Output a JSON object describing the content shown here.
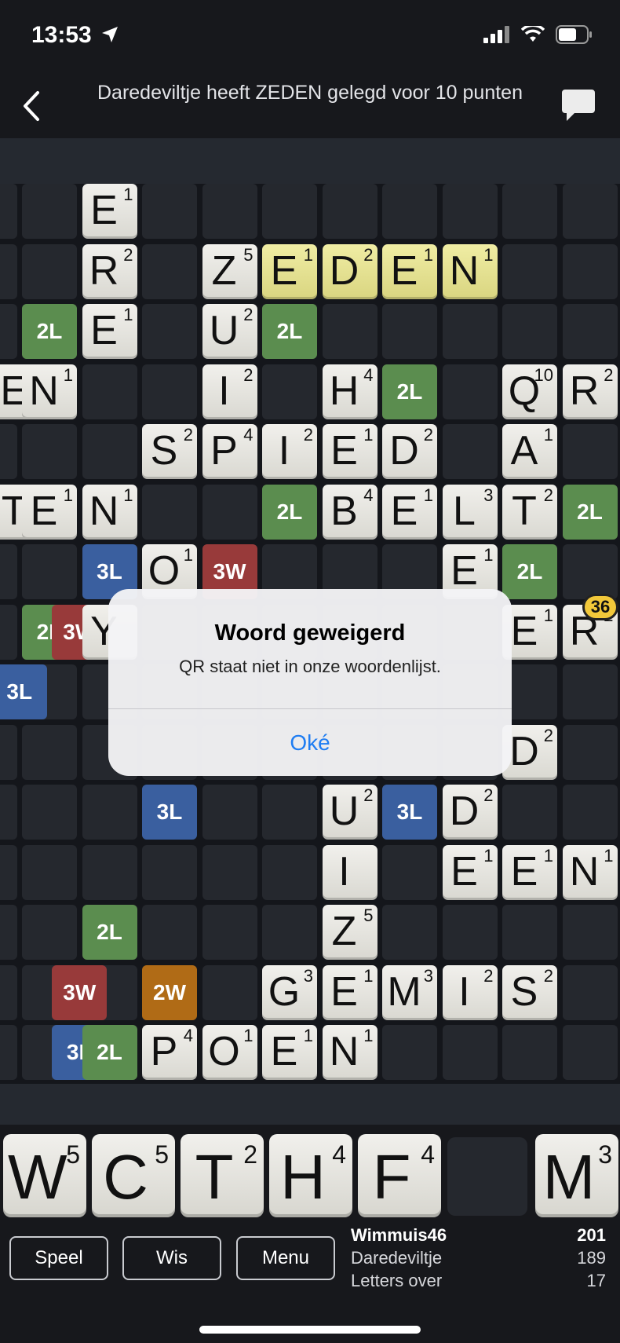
{
  "status": {
    "time": "13:53"
  },
  "nav": {
    "title": "Daredeviltje heeft ZEDEN gelegd voor 10 punten"
  },
  "colors": {
    "accent": "#1f7df2",
    "last_move": "#e6e298",
    "score_badge": "#f2c83a"
  },
  "board": {
    "bonuses": [
      {
        "r": 2,
        "c": 0,
        "t": "2L"
      },
      {
        "r": 2,
        "c": 4,
        "t": "2L"
      },
      {
        "r": 3,
        "c": 6,
        "t": "2L"
      },
      {
        "r": 5,
        "c": 4,
        "t": "2L"
      },
      {
        "r": 5,
        "c": 9,
        "t": "2L"
      },
      {
        "r": 6,
        "c": 1,
        "t": "3L"
      },
      {
        "r": 6,
        "c": 3,
        "t": "3W"
      },
      {
        "r": 6,
        "c": 8,
        "t": "2L"
      },
      {
        "r": 7,
        "c": 0,
        "t": "2L"
      },
      {
        "r": 7,
        "c": 0.5,
        "t": "3W"
      },
      {
        "r": 8,
        "c": -0.5,
        "t": "3L"
      },
      {
        "r": 10,
        "c": 2,
        "t": "3L"
      },
      {
        "r": 10,
        "c": 6,
        "t": "3L"
      },
      {
        "r": 12,
        "c": 1,
        "t": "2L"
      },
      {
        "r": 13,
        "c": 0.5,
        "t": "3W"
      },
      {
        "r": 13,
        "c": 2,
        "t": "2W"
      },
      {
        "r": 14,
        "c": 0.5,
        "t": "3L"
      },
      {
        "r": 14,
        "c": 1,
        "t": "2L"
      }
    ],
    "tiles": [
      {
        "r": 0,
        "c": 1,
        "l": "E",
        "p": "1"
      },
      {
        "r": 1,
        "c": 1,
        "l": "R",
        "p": "2"
      },
      {
        "r": 1,
        "c": 3,
        "l": "Z",
        "p": "5"
      },
      {
        "r": 1,
        "c": 4,
        "l": "E",
        "p": "1",
        "last": true
      },
      {
        "r": 1,
        "c": 5,
        "l": "D",
        "p": "2",
        "last": true
      },
      {
        "r": 1,
        "c": 6,
        "l": "E",
        "p": "1",
        "last": true
      },
      {
        "r": 1,
        "c": 7,
        "l": "N",
        "p": "1",
        "last": true
      },
      {
        "r": 2,
        "c": 1,
        "l": "E",
        "p": "1"
      },
      {
        "r": 2,
        "c": 3,
        "l": "U",
        "p": "2"
      },
      {
        "r": 3,
        "c": -0.5,
        "l": "E",
        "p": "1"
      },
      {
        "r": 3,
        "c": 0,
        "l": "N",
        "p": "1"
      },
      {
        "r": 3,
        "c": 3,
        "l": "I",
        "p": "2"
      },
      {
        "r": 3,
        "c": 5,
        "l": "H",
        "p": "4"
      },
      {
        "r": 3,
        "c": 8,
        "l": "Q",
        "p": "10"
      },
      {
        "r": 3,
        "c": 9,
        "l": "R",
        "p": "2"
      },
      {
        "r": 4,
        "c": 2,
        "l": "S",
        "p": "2"
      },
      {
        "r": 4,
        "c": 3,
        "l": "P",
        "p": "4"
      },
      {
        "r": 4,
        "c": 4,
        "l": "I",
        "p": "2"
      },
      {
        "r": 4,
        "c": 5,
        "l": "E",
        "p": "1"
      },
      {
        "r": 4,
        "c": 6,
        "l": "D",
        "p": "2"
      },
      {
        "r": 4,
        "c": 8,
        "l": "A",
        "p": "1"
      },
      {
        "r": 5,
        "c": -0.5,
        "l": "T",
        "p": "2"
      },
      {
        "r": 5,
        "c": 0,
        "l": "E",
        "p": "1"
      },
      {
        "r": 5,
        "c": 1,
        "l": "N",
        "p": "1"
      },
      {
        "r": 5,
        "c": 5,
        "l": "B",
        "p": "4"
      },
      {
        "r": 5,
        "c": 6,
        "l": "E",
        "p": "1"
      },
      {
        "r": 5,
        "c": 7,
        "l": "L",
        "p": "3"
      },
      {
        "r": 5,
        "c": 8,
        "l": "T",
        "p": "2"
      },
      {
        "r": 6,
        "c": 2,
        "l": "O",
        "p": "1"
      },
      {
        "r": 6,
        "c": 7,
        "l": "E",
        "p": "1"
      },
      {
        "r": 7,
        "c": 1,
        "l": "Y",
        "p": ""
      },
      {
        "r": 7,
        "c": 8,
        "l": "E",
        "p": "1"
      },
      {
        "r": 7,
        "c": 9,
        "l": "R",
        "p": "2"
      },
      {
        "r": 9,
        "c": 8,
        "l": "D",
        "p": "2"
      },
      {
        "r": 10,
        "c": 5,
        "l": "U",
        "p": "2"
      },
      {
        "r": 10,
        "c": 7,
        "l": "D",
        "p": "2"
      },
      {
        "r": 11,
        "c": 5,
        "l": "I",
        "p": ""
      },
      {
        "r": 11,
        "c": 7,
        "l": "E",
        "p": "1"
      },
      {
        "r": 11,
        "c": 8,
        "l": "E",
        "p": "1"
      },
      {
        "r": 11,
        "c": 9,
        "l": "N",
        "p": "1"
      },
      {
        "r": 12,
        "c": 5,
        "l": "Z",
        "p": "5"
      },
      {
        "r": 13,
        "c": 4,
        "l": "G",
        "p": "3"
      },
      {
        "r": 13,
        "c": 5,
        "l": "E",
        "p": "1"
      },
      {
        "r": 13,
        "c": 6,
        "l": "M",
        "p": "3"
      },
      {
        "r": 13,
        "c": 7,
        "l": "I",
        "p": "2"
      },
      {
        "r": 13,
        "c": 8,
        "l": "S",
        "p": "2"
      },
      {
        "r": 14,
        "c": 2,
        "l": "P",
        "p": "4"
      },
      {
        "r": 14,
        "c": 3,
        "l": "O",
        "p": "1"
      },
      {
        "r": 14,
        "c": 4,
        "l": "E",
        "p": "1"
      },
      {
        "r": 14,
        "c": 5,
        "l": "N",
        "p": "1"
      }
    ],
    "score_preview": "36"
  },
  "rack": {
    "tiles": [
      {
        "l": "W",
        "p": "5"
      },
      {
        "l": "C",
        "p": "5"
      },
      {
        "l": "T",
        "p": "2"
      },
      {
        "l": "H",
        "p": "4"
      },
      {
        "l": "F",
        "p": "4"
      },
      {
        "l": "",
        "p": ""
      },
      {
        "l": "M",
        "p": "3"
      }
    ]
  },
  "buttons": {
    "play": "Speel",
    "clear": "Wis",
    "menu": "Menu"
  },
  "scores": {
    "rows": [
      {
        "name": "Wimmuis46",
        "value": "201"
      },
      {
        "name": "Daredeviltje",
        "value": "189"
      },
      {
        "name": "Letters over",
        "value": "17"
      }
    ]
  },
  "alert": {
    "title": "Woord geweigerd",
    "message": "QR staat niet in onze woordenlijst.",
    "ok": "Oké"
  }
}
